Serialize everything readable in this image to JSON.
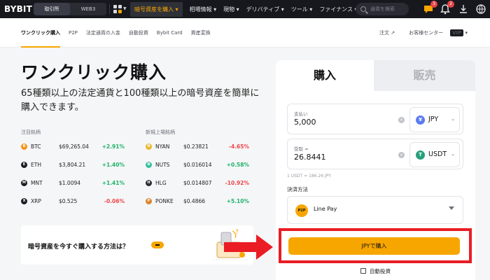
{
  "topnav": {
    "logo": "BYBIT",
    "segments": [
      "取引所",
      "WEB3"
    ],
    "links": [
      "暗号資産を購入 ▾",
      "相場情報 ▾",
      "現物 ▾",
      "デリバティブ ▾",
      "ツール ▾",
      "ファイナンス ▾"
    ],
    "search_placeholder": "通貨を検索",
    "notify_badge": "3",
    "bell_badge": "2"
  },
  "subnav": {
    "tabs": [
      "ワンクリック購入",
      "P2P",
      "法定通貨の入金",
      "自動投資",
      "Bybit Card",
      "資産変換"
    ],
    "right": {
      "orders": "注文 ↗",
      "support": "お客様センター",
      "vip": "VIP"
    }
  },
  "hero": {
    "title": "ワンクリック購入",
    "subtitle": "65種類以上の法定通貨と100種類以上の暗号資産を簡単に購入できます。"
  },
  "hot": {
    "title": "注目銘柄",
    "rows": [
      {
        "icon": "B",
        "symbol": "BTC",
        "price": "$69,265.04",
        "change": "+2.91%",
        "dir": "up",
        "color": "#f7931a"
      },
      {
        "icon": "E",
        "symbol": "ETH",
        "price": "$3,804.21",
        "change": "+1.40%",
        "dir": "up",
        "color": "#1c1d22"
      },
      {
        "icon": "M",
        "symbol": "MNT",
        "price": "$1.0094",
        "change": "+1.41%",
        "dir": "up",
        "color": "#1c1d22"
      },
      {
        "icon": "X",
        "symbol": "XRP",
        "price": "$0.525",
        "change": "-0.06%",
        "dir": "down",
        "color": "#1c1d22"
      }
    ]
  },
  "new": {
    "title": "新規上場銘柄",
    "rows": [
      {
        "icon": "N",
        "symbol": "NYAN",
        "price": "$0.23821",
        "change": "-4.65%",
        "dir": "down",
        "color": "#e9b72b"
      },
      {
        "icon": "N",
        "symbol": "NUTS",
        "price": "$0.016014",
        "change": "+0.58%",
        "dir": "up",
        "color": "#3bbfa0"
      },
      {
        "icon": "H",
        "symbol": "HLG",
        "price": "$0.014807",
        "change": "-10.92%",
        "dir": "down",
        "color": "#2b2d33"
      },
      {
        "icon": "P",
        "symbol": "PONKE",
        "price": "$0.4866",
        "change": "+5.10%",
        "dir": "up",
        "color": "#d9862b"
      }
    ]
  },
  "howto": {
    "question": "暗号資産を今すぐ購入する方法は？"
  },
  "card": {
    "tab_buy": "購入",
    "tab_sell": "販売",
    "pay": {
      "label": "支払い",
      "value": "5,000",
      "currency": "JPY",
      "icon": "¥",
      "icon_color": "#5b7cf3"
    },
    "receive": {
      "label": "受取 ≈",
      "value": "26.8441",
      "currency": "USDT",
      "icon": "T",
      "icon_color": "#26a17b"
    },
    "rate": "1 USDT = 186.26 JPY",
    "method_label": "決済方法",
    "method": {
      "name": "Line Pay",
      "icon": "P2P"
    },
    "buy_button": "JPYで購入",
    "recurring": "自動投資"
  },
  "colors": {
    "accent": "#f7a600",
    "up": "#20b26c",
    "down": "#ef454a",
    "highlight": "#ea1c24"
  }
}
